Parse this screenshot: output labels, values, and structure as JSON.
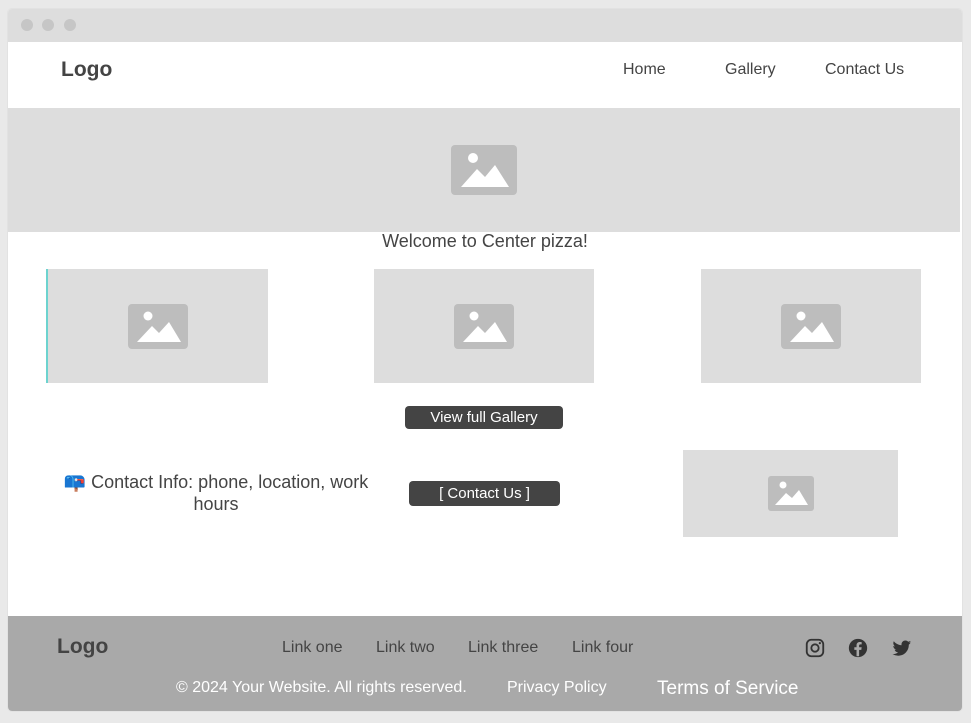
{
  "window": {
    "title_dots": [
      "close-dot",
      "minimize-dot",
      "maximize-dot"
    ]
  },
  "header": {
    "logo": "Logo",
    "nav": {
      "home": "Home",
      "gallery": "Gallery",
      "contact": "Contact Us"
    }
  },
  "main": {
    "welcome": "Welcome to Center pizza!",
    "gallery_button": "View full Gallery",
    "contact_info_icon": "📪",
    "contact_info": "Contact Info: phone, location, work hours",
    "contact_button": "[ Contact Us ]"
  },
  "footer": {
    "logo": "Logo",
    "links": {
      "one": "Link one",
      "two": "Link two",
      "three": "Link three",
      "four": "Link four"
    },
    "copyright": "© 2024 Your Website. All rights reserved.",
    "privacy": "Privacy Policy",
    "terms": "Terms of Service",
    "social_icons": [
      "instagram-icon",
      "facebook-icon",
      "twitter-icon"
    ]
  },
  "colors": {
    "placeholder_bg": "#dddddd",
    "placeholder_icon": "#bdbdbd",
    "button_bg": "#444444",
    "footer_bg": "#a9a9a9",
    "text": "#444444"
  }
}
